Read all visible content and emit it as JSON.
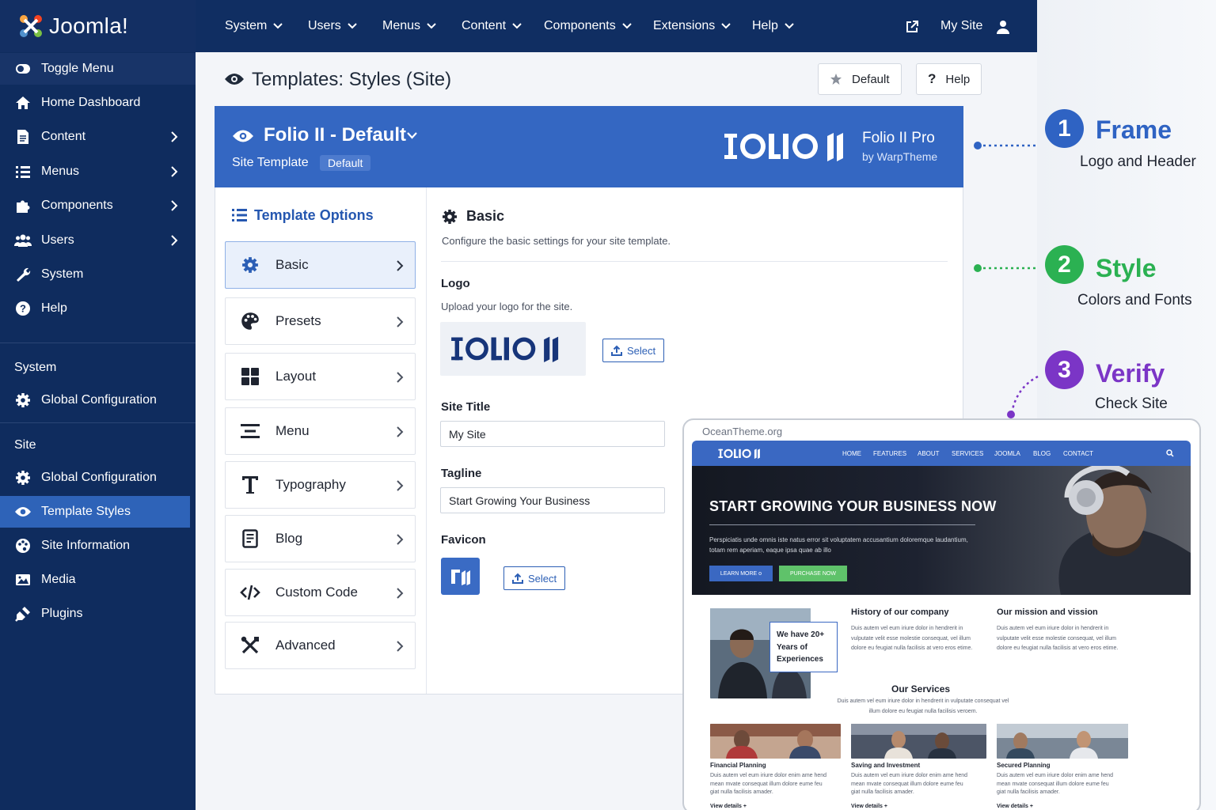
{
  "app": {
    "logo_text": "Joomla!"
  },
  "sidebar": {
    "items": [
      {
        "label": "Toggle Menu",
        "icon": "toggle-icon"
      },
      {
        "label": "Home Dashboard",
        "icon": "home-icon"
      },
      {
        "label": "Content",
        "icon": "file-icon"
      },
      {
        "label": "Menus",
        "icon": "list-icon"
      },
      {
        "label": "Components",
        "icon": "puzzle-icon"
      },
      {
        "label": "Users",
        "icon": "users-icon"
      },
      {
        "label": "System",
        "icon": "wrench-icon"
      },
      {
        "label": "Help",
        "icon": "help-icon"
      }
    ],
    "system_section": "System",
    "system_items": [
      {
        "label": "Global Configuration",
        "icon": "gear-icon"
      }
    ],
    "site_section": "Site",
    "site_items": [
      {
        "label": "Global Configuration",
        "icon": "gear-icon"
      },
      {
        "label": "Template Styles",
        "icon": "eye-icon"
      },
      {
        "label": "Site Information",
        "icon": "palette-icon"
      },
      {
        "label": "Media",
        "icon": "image-icon"
      },
      {
        "label": "Plugins",
        "icon": "plug-icon"
      }
    ]
  },
  "topbar": {
    "menus": [
      "System",
      "Users",
      "Menus",
      "Content",
      "Components",
      "Extensions",
      "Help"
    ],
    "site_link": "My Site"
  },
  "toolbar": {
    "page_title": "Templates: Styles (Site)",
    "default_label": "Default",
    "help_label": "Help"
  },
  "template": {
    "title": "Folio II - Default",
    "subtitle": "Site Template",
    "badge": "Default",
    "brand_name": "Folio II Pro",
    "brand_by": "by WarpTheme"
  },
  "options": {
    "title": "Template Options",
    "items": [
      "Basic",
      "Presets",
      "Layout",
      "Menu",
      "Typography",
      "Blog",
      "Custom Code",
      "Advanced"
    ]
  },
  "basic": {
    "title": "Basic",
    "description": "Configure the basic settings for your site template.",
    "logo_label": "Logo",
    "logo_desc": "Upload your logo for the site.",
    "select_label": "Select",
    "site_title_label": "Site Title",
    "site_title_value": "My Site",
    "tagline_label": "Tagline",
    "tagline_value": "Start Growing Your Business",
    "favicon_label": "Favicon"
  },
  "steps": [
    {
      "num": "1",
      "title": "Frame",
      "subtitle": "Logo and Header",
      "color": "#2f63c3"
    },
    {
      "num": "2",
      "title": "Style",
      "subtitle": "Colors and Fonts",
      "color": "#2bb152"
    },
    {
      "num": "3",
      "title": "Verify",
      "subtitle": "Check Site",
      "color": "#7b35c6"
    }
  ],
  "preview": {
    "url": "OceanTheme.org",
    "nav": [
      "HOME",
      "FEATURES",
      "ABOUT",
      "SERVICES",
      "JOOMLA",
      "BLOG",
      "CONTACT"
    ],
    "hero_title": "START GROWING YOUR BUSINESS NOW",
    "hero_text": "Perspiciatis unde omnis iste natus error sit voluptatem accusantium doloremque laudantium, totam rem aperiam, eaque ipsa quae ab illo",
    "btn_learn": "LEARN MORE",
    "btn_purchase": "PURCHASE NOW",
    "badge_text": "We have 20+ Years of Experiences",
    "history_title": "History of our company",
    "history_text": "Duis autem vel eum iriure dolor in hendrerit in vulputate velit esse molestie consequat, vel illum dolore eu feugiat nulla facilisis at vero eros etime.",
    "mission_title": "Our mission and vission",
    "mission_text": "Duis autem vel eum iriure dolor in hendrerit in vulputate velit esse molestie consequat, vel illum dolore eu feugiat nulla facilisis at vero eros etime.",
    "services_title": "Our Services",
    "services_text": "Duis autem vel eum iriure dolor in hendrerit in vulputate consequat vel illum dolore eu feugiat nulla facilisis veroem.",
    "cards": [
      {
        "title": "Financial Planning",
        "text": "Duis autem vel eum iriure dolor enim ame hend mean mvate consequat illum dolore eume feu giat nulla facilisis amader.",
        "link": "View details +"
      },
      {
        "title": "Saving and Investment",
        "text": "Duis autem vel eum iriure dolor enim ame hend mean mvate consequat illum dolore eume feu giat nulla facilisis amader.",
        "link": "View details +"
      },
      {
        "title": "Secured Planning",
        "text": "Duis autem vel eum iriure dolor enim ame hend mean mvate consequat illum dolore eume feu giat nulla facilisis amader.",
        "link": "View details +"
      }
    ]
  },
  "colors": {
    "sidebar": "#0f2c5e",
    "topbar": "#102e62",
    "accent": "#3467c2",
    "active_nav": "#2e63b8"
  }
}
